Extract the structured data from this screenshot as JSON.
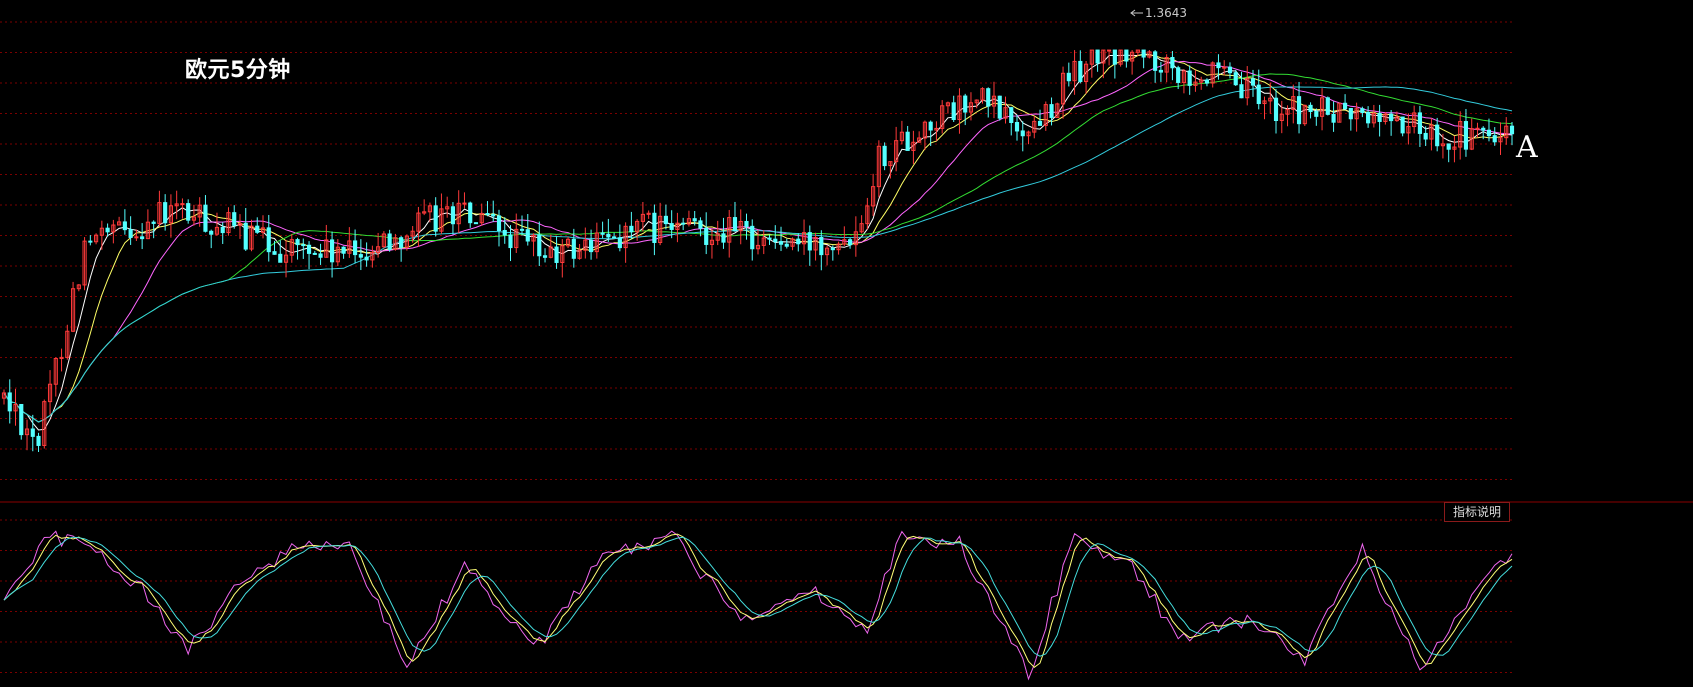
{
  "header": {
    "title": "欧元5分钟",
    "side_label": "A"
  },
  "indicator_button": {
    "label": "指标说明"
  },
  "colors": {
    "background": "#000000",
    "grid": "#7a0000",
    "up": "#ff3a3a",
    "down": "#54ffff",
    "ma1": "#ffffff",
    "ma2": "#ffff66",
    "ma3": "#ff66ff",
    "ma4": "#33dd33",
    "ma5": "#33ccdd",
    "osc_k": "#ee66ee",
    "osc_d": "#ffff77",
    "osc_j": "#44dddd"
  },
  "chart_data": [
    {
      "type": "candlestick",
      "title": "欧元5分钟",
      "max_label": "1.3643",
      "ylim": [
        1.355,
        1.365
      ],
      "anchors": [
        [
          0,
          1.3567
        ],
        [
          6,
          1.3558
        ],
        [
          14,
          1.36
        ],
        [
          30,
          1.3608
        ],
        [
          48,
          1.36
        ],
        [
          60,
          1.3598
        ],
        [
          78,
          1.3608
        ],
        [
          95,
          1.3598
        ],
        [
          110,
          1.3604
        ],
        [
          125,
          1.3604
        ],
        [
          138,
          1.36
        ],
        [
          148,
          1.3604
        ],
        [
          152,
          1.362
        ],
        [
          162,
          1.3628
        ],
        [
          170,
          1.3632
        ],
        [
          178,
          1.3625
        ],
        [
          184,
          1.3635
        ],
        [
          190,
          1.3643
        ],
        [
          200,
          1.3641
        ],
        [
          210,
          1.3637
        ],
        [
          222,
          1.363
        ],
        [
          240,
          1.3628
        ],
        [
          252,
          1.3624
        ],
        [
          262,
          1.3624
        ]
      ],
      "ma_series": [
        "MA5",
        "MA10",
        "MA20",
        "MA40",
        "MA60"
      ],
      "max_value": 1.3643
    },
    {
      "type": "line",
      "series": [
        "K",
        "D",
        "J"
      ],
      "ylim": [
        0,
        100
      ],
      "anchors": [
        [
          0,
          50
        ],
        [
          8,
          95
        ],
        [
          16,
          85
        ],
        [
          24,
          60
        ],
        [
          32,
          20
        ],
        [
          40,
          60
        ],
        [
          50,
          85
        ],
        [
          60,
          90
        ],
        [
          70,
          10
        ],
        [
          80,
          75
        ],
        [
          92,
          20
        ],
        [
          104,
          80
        ],
        [
          116,
          95
        ],
        [
          128,
          40
        ],
        [
          140,
          60
        ],
        [
          150,
          35
        ],
        [
          156,
          95
        ],
        [
          166,
          90
        ],
        [
          178,
          5
        ],
        [
          186,
          95
        ],
        [
          196,
          75
        ],
        [
          204,
          30
        ],
        [
          216,
          40
        ],
        [
          226,
          15
        ],
        [
          236,
          85
        ],
        [
          246,
          10
        ],
        [
          262,
          85
        ]
      ]
    }
  ]
}
